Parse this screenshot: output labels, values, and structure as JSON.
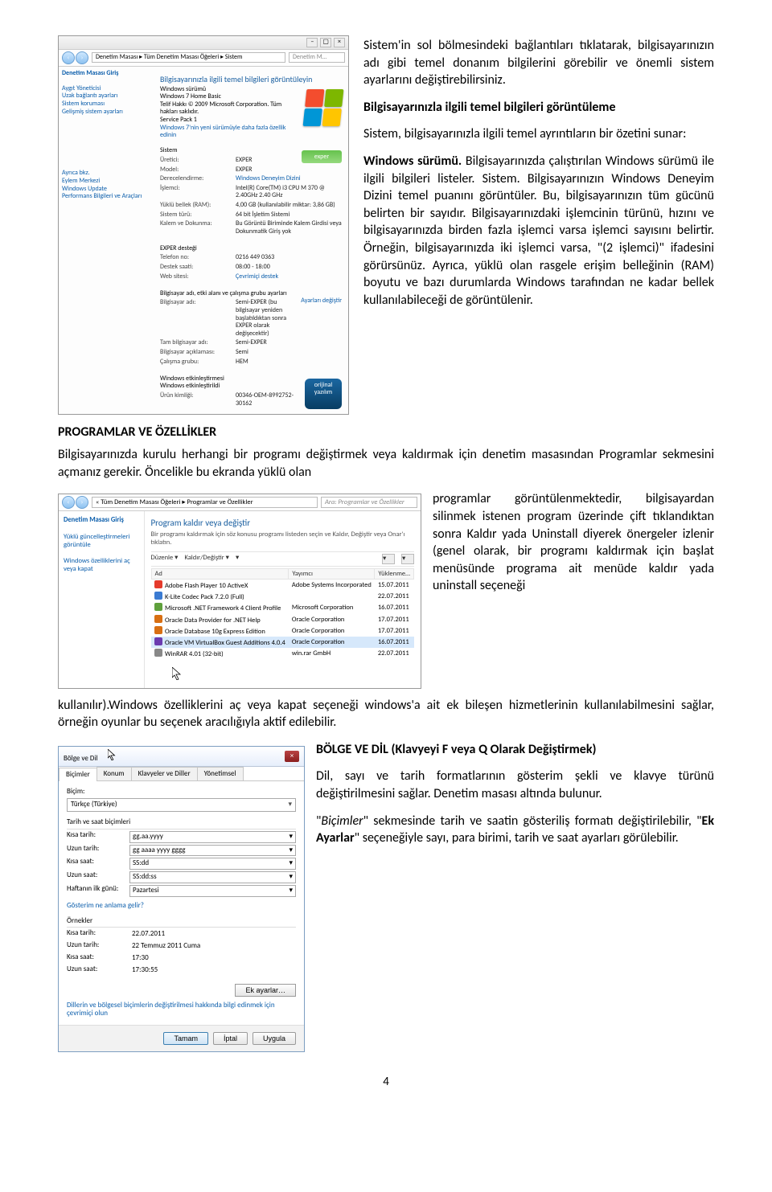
{
  "text": {
    "p1a": "Sistem'in sol bölmesindeki bağlantıları tıklatarak, bilgisayarınızın adı gibi temel donanım bilgilerini görebilir ve önemli sistem ayarlarını değiştirebilirsiniz.",
    "h1": "Bilgisayarınızla ilgili temel bilgileri görüntüleme",
    "p2": "Sistem, bilgisayarınızla ilgili temel ayrıntıların bir özetini sunar:",
    "p3_pre": "Windows sürümü.",
    "p3_rest": " Bilgisayarınızda çalıştırılan Windows sürümü ile ilgili bilgileri listeler. Sistem. Bilgisayarınızın Windows Deneyim Dizini temel puanını görüntüler. Bu, bilgisayarınızın tüm gücünü belirten bir sayıdır. Bilgisayarınızdaki işlemcinin türünü, hızını ve bilgisayarınızda birden fazla işlemci varsa işlemci sayısını belirtir. Örneğin, bilgisayarınızda iki işlemci varsa, \"(2 işlemci)\" ifadesini görürsünüz. Ayrıca, yüklü olan rasgele erişim belleğinin (RAM) boyutu ve bazı durumlarda Windows tarafından ne kadar bellek kullanılabileceği de görüntülenir.",
    "h2": "PROGRAMLAR VE ÖZELLİKLER",
    "p4": "Bilgisayarınızda kurulu herhangi bir programı değiştirmek veya kaldırmak için denetim masasından Programlar sekmesini açmanız gerekir. Öncelikle bu ekranda yüklü olan",
    "p5": "programlar görüntülenmektedir, bilgisayardan silinmek istenen program üzerinde çift tıklandıktan sonra Kaldır yada Uninstall diyerek önergeler izlenir (genel olarak, bir programı kaldırmak için başlat menüsünde programa ait menüde kaldır yada uninstall seçeneği",
    "p6": "kullanılır).Windows özelliklerini aç veya kapat seçeneği windows'a ait ek bileşen hizmetlerinin kullanılabilmesini sağlar, örneğin oyunlar bu seçenek aracılığıyla aktif edilebilir.",
    "h3": "BÖLGE VE DİL (Klavyeyi F veya Q Olarak Değiştirmek)",
    "p7": "Dil, sayı ve tarih formatlarının gösterim şekli ve klavye türünü değiştirilmesini sağlar. Denetim masası altında bulunur.",
    "p8a": "\"",
    "p8b": "Biçimler",
    "p8c": "\" sekmesinde tarih ve saatin gösteriliş formatı değiştirilebilir, \"",
    "p8d": "Ek Ayarlar",
    "p8e": "\" seçeneğiyle sayı, para birimi, tarih ve saat ayarları görülebilir.",
    "page_no": "4"
  },
  "sys": {
    "addr_path": "Denetim Masası ▸ Tüm Denetim Masası Öğeleri ▸ Sistem",
    "search": "Denetim M…",
    "side_title": "Denetim Masası Giriş",
    "side1": "Aygıt Yöneticisi",
    "side2": "Uzak bağlantı ayarları",
    "side3": "Sistem koruması",
    "side4": "Gelişmiş sistem ayarları",
    "see_also1": "Eylem Merkezi",
    "see_also2": "Windows Update",
    "see_also3": "Performans Bilgileri ve Araçları",
    "main_title": "Bilgisayarınızla ilgili temel bilgileri görüntüleyin",
    "sec1": "Windows sürümü",
    "edition": "Windows 7 Home Basic",
    "copyright": "Telif Hakkı © 2009 Microsoft Corporation. Tüm hakları saklıdır.",
    "sp": "Service Pack 1",
    "moreft": "Windows 7'nin yeni sürümüyle daha fazla özellik edinin",
    "sec2": "Sistem",
    "r_rating_k": "Üretici:",
    "r_rating_v": "EXPER",
    "r_model_k": "Model:",
    "r_model_v": "EXPER",
    "r_index_k": "Derecelendirme:",
    "r_index_v": "Windows Deneyim Dizini",
    "r_cpu_k": "İşlemci:",
    "r_cpu_v": "Intel(R) Core(TM) i3 CPU   M 370 @ 2.40GHz  2.40 GHz",
    "r_ram_k": "Yüklü bellek (RAM):",
    "r_ram_v": "4,00 GB (kullanılabilir miktar: 3,86 GB)",
    "r_type_k": "Sistem türü:",
    "r_type_v": "64 bit İşletim Sistemi",
    "r_pen_k": "Kalem ve Dokunma:",
    "r_pen_v": "Bu Görüntü Biriminde Kalem Girdisi veya Dokunmatik Giriş yok",
    "sec3": "EXPER desteği",
    "r_tel_k": "Telefon no:",
    "r_tel_v": "0216 449 0363",
    "r_hours_k": "Destek saati:",
    "r_hours_v": "08:00 - 18:00",
    "r_web_k": "Web sitesi:",
    "r_web_v": "Çevrimiçi destek",
    "sec4": "Bilgisayar adı, etki alanı ve çalışma grubu ayarları",
    "r_pc_k": "Bilgisayar adı:",
    "r_pc_v": "Semi-EXPER (bu bilgisayar yeniden başlatıldıktan sonra EXPER olarak değişecektir)",
    "r_full_k": "Tam bilgisayar adı:",
    "r_full_v": "Semi-EXPER",
    "r_desc_k": "Bilgisayar açıklaması:",
    "r_desc_v": "Semi",
    "r_wg_k": "Çalışma grubu:",
    "r_wg_v": "HEM",
    "change_settings": "Ayarları değiştir",
    "sec5": "Windows etkinleştirmesi",
    "act_text": "Windows etkinleştirildi",
    "prodid_k": "Ürün kimliği:",
    "prodid_v": "00346-OEM-8992752-30162",
    "genuine1": "orijinal",
    "genuine2": "yazılım"
  },
  "prog": {
    "addr_path": "« Tüm Denetim Masası Öğeleri ▸ Programlar ve Özellikler",
    "search_ph": "Ara: Programlar ve Özellikler",
    "side_title": "Denetim Masası Giriş",
    "side1": "Yüklü güncelleştirmeleri görüntüle",
    "side2": "Windows özelliklerini aç veya kapat",
    "main_h": "Program kaldır veya değiştir",
    "main_sub": "Bir programı kaldırmak için söz konusu programı listeden seçin ve Kaldır, Değiştir veya Onar'ı tıklatın.",
    "tool1": "Düzenle",
    "tool2": "Kaldır/Değiştir",
    "col1": "Ad",
    "col2": "Yayımcı",
    "col3": "Yüklenme…",
    "rows": [
      {
        "icon": "ic-red",
        "n": "Adobe Flash Player 10 ActiveX",
        "p": "Adobe Systems Incorporated",
        "d": "15.07.2011"
      },
      {
        "icon": "ic-blue",
        "n": "K-Lite Codec Pack 7.2.0 (Full)",
        "p": "",
        "d": "22.07.2011"
      },
      {
        "icon": "ic-g",
        "n": "Microsoft .NET Framework 4 Client Profile",
        "p": "Microsoft Corporation",
        "d": "16.07.2011"
      },
      {
        "icon": "ic-o",
        "n": "Oracle Data Provider for .NET Help",
        "p": "Oracle Corporation",
        "d": "17.07.2011"
      },
      {
        "icon": "ic-o",
        "n": "Oracle Database 10g Express Edition",
        "p": "Oracle Corporation",
        "d": "17.07.2011"
      },
      {
        "icon": "ic-p",
        "n": "Oracle VM VirtualBox Guest Additions 4.0.4",
        "p": "Oracle Corporation",
        "d": "16.07.2011",
        "sel": true
      },
      {
        "icon": "ic-gy",
        "n": "WinRAR 4.01 (32-bit)",
        "p": "win.rar GmbH",
        "d": "22.07.2011"
      }
    ]
  },
  "region": {
    "title": "Bölge ve Dil",
    "tabs": [
      "Biçimler",
      "Konum",
      "Klavyeler ve Diller",
      "Yönetimsel"
    ],
    "format_lbl": "Biçim:",
    "format_val": "Türkçe (Türkiye)",
    "datefmt_h": "Tarih ve saat biçimleri",
    "k_sdate": "Kısa tarih:",
    "v_sdate": "gg.aa.yyyy",
    "k_ldate": "Uzun tarih:",
    "v_ldate": "gg aaaa yyyy gggg",
    "k_stime": "Kısa saat:",
    "v_stime": "SS:dd",
    "k_ltime": "Uzun saat:",
    "v_ltime": "SS:dd:ss",
    "k_fdow": "Haftanın ilk günü:",
    "v_fdow": "Pazartesi",
    "what_link": "Gösterim ne anlama gelir?",
    "examples_h": "Örnekler",
    "ex_sdate_v": "22.07.2011",
    "ex_ldate_v": "22 Temmuz 2011 Cuma",
    "ex_stime_v": "17:30",
    "ex_ltime_v": "17:30:55",
    "extra_btn": "Ek ayarlar…",
    "change_link": "Dillerin ve bölgesel biçimlerin değiştirilmesi hakkında bilgi edinmek için çevrimiçi olun",
    "btn_ok": "Tamam",
    "btn_cancel": "İptal",
    "btn_apply": "Uygula"
  }
}
